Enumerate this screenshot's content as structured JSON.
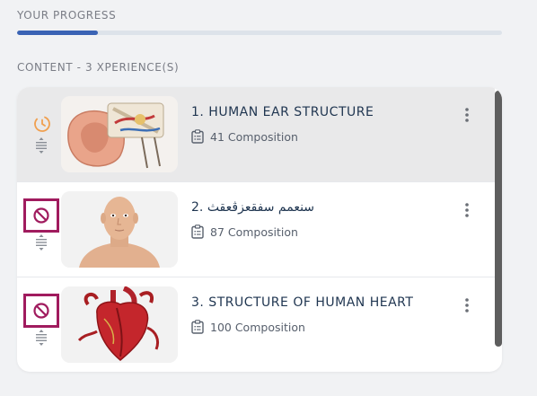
{
  "progress": {
    "heading": "YOUR PROGRESS",
    "fraction": 0.167,
    "fill_color": "#3a63b4",
    "track_color": "#dde3ea"
  },
  "content": {
    "heading": "CONTENT - 3 XPERIENCE(S)"
  },
  "items": [
    {
      "title": "1. HUMAN EAR STRUCTURE",
      "composition": "41 Composition",
      "status_icon": "clock-icon",
      "thumbnail": "human-ear-model",
      "active": true
    },
    {
      "title": "2. سنعمم سفقعزڨعقث",
      "composition": "87 Composition",
      "status_icon": "blocked-icon",
      "thumbnail": "human-head-model",
      "active": false
    },
    {
      "title": "3. STRUCTURE OF HUMAN HEART",
      "composition": "100 Composition",
      "status_icon": "blocked-icon",
      "thumbnail": "human-heart-model",
      "active": false
    }
  ],
  "colors": {
    "accent_blocked": "#a01b5e",
    "clock_orange": "#f0a050",
    "title_navy": "#1f3550"
  }
}
